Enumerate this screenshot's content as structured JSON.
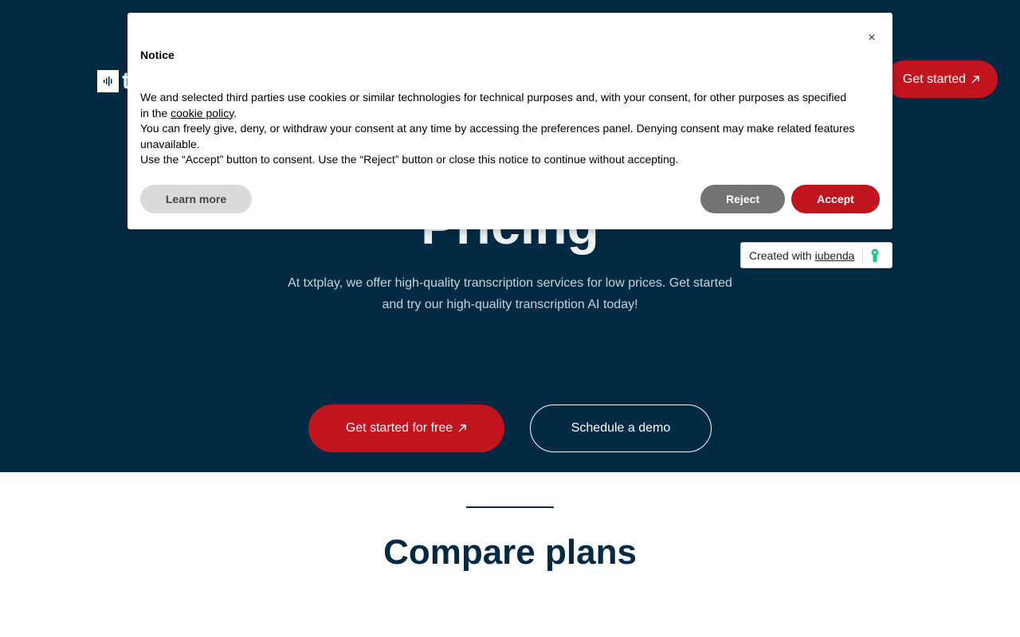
{
  "header": {
    "logo_text": "t",
    "cta_label": "Get started"
  },
  "hero": {
    "title": "Pricing",
    "subtitle": "At txtplay, we offer high-quality transcription services for low prices. Get started and try our high-quality transcription AI today!",
    "primary_button": "Get started for free",
    "secondary_button": "Schedule a demo"
  },
  "compare": {
    "title": "Compare plans"
  },
  "cookie_notice": {
    "title": "Notice",
    "close_symbol": "×",
    "paragraph1_before": "We and selected third parties use cookies or similar technologies for technical purposes and, with your consent, for other purposes as specified in the ",
    "policy_link": "cookie policy",
    "paragraph1_after": ".",
    "paragraph2": "You can freely give, deny, or withdraw your consent at any time by accessing the preferences panel. Denying consent may make related features unavailable.",
    "paragraph3": "Use the “Accept” button to consent. Use the “Reject” button or close this notice to continue without accepting.",
    "learn_more": "Learn more",
    "reject": "Reject",
    "accept": "Accept"
  },
  "iubenda_badge": {
    "prefix": "Created with",
    "link": "iubenda"
  },
  "colors": {
    "navy": "#022a42",
    "brand_red": "#c0141f",
    "reject_gray": "#737373",
    "learn_gray": "#dadada",
    "iubenda_green": "#1cc691"
  },
  "icons": [
    "arrow-up-right-icon",
    "close-icon",
    "logo-waveform-icon",
    "iubenda-keyhole-icon"
  ]
}
